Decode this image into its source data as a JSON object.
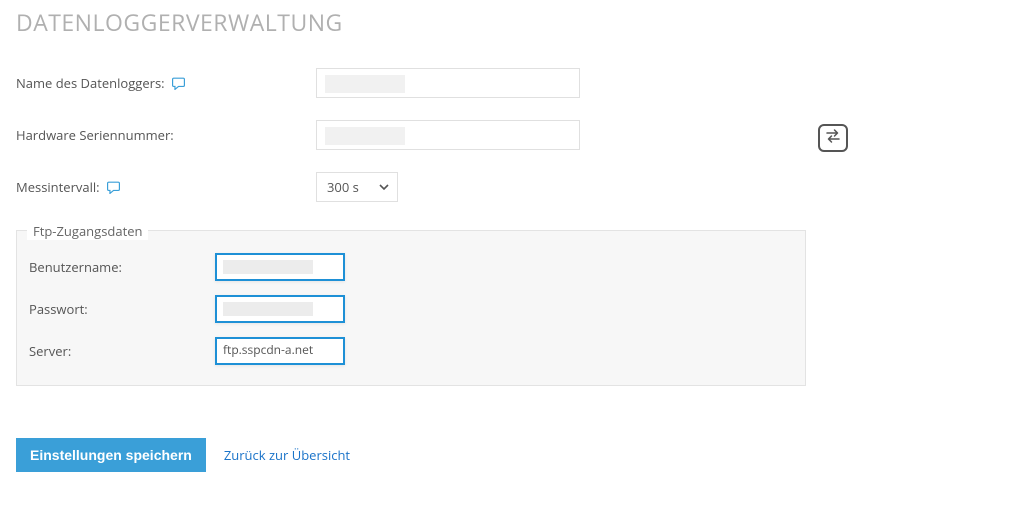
{
  "page": {
    "title": "DATENLOGGERVERWALTUNG"
  },
  "form": {
    "name": {
      "label": "Name des Datenloggers:",
      "value": ""
    },
    "serial": {
      "label": "Hardware Seriennummer:",
      "value": ""
    },
    "interval": {
      "label": "Messintervall:",
      "selected": "300 s"
    }
  },
  "ftp": {
    "legend": "Ftp-Zugangsdaten",
    "username": {
      "label": "Benutzername:",
      "value": ""
    },
    "password": {
      "label": "Passwort:",
      "value": ""
    },
    "server": {
      "label": "Server:",
      "value": "ftp.sspcdn-a.net"
    }
  },
  "actions": {
    "save": "Einstellungen speichern",
    "back": "Zurück zur Übersicht"
  }
}
